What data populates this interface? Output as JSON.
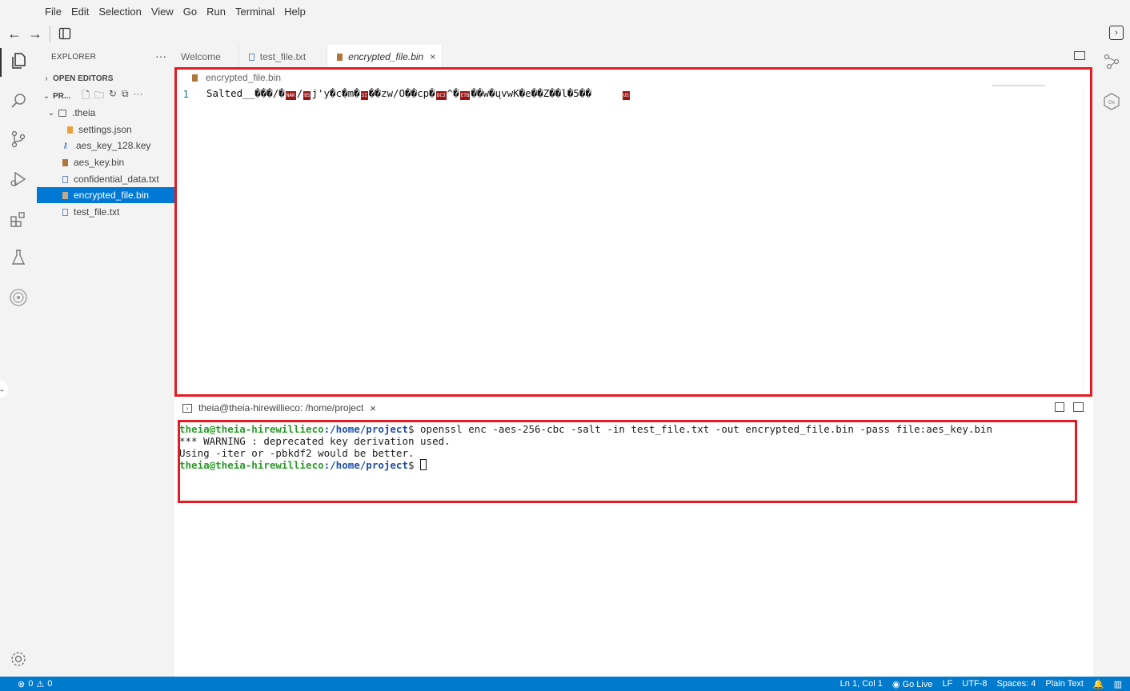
{
  "menu": {
    "items": [
      "File",
      "Edit",
      "Selection",
      "View",
      "Go",
      "Run",
      "Terminal",
      "Help"
    ]
  },
  "explorer": {
    "title": "EXPLORER",
    "open_editors": "OPEN EDITORS",
    "project": "PR...",
    "tree": [
      {
        "label": ".theia",
        "type": "folder"
      },
      {
        "label": "settings.json",
        "type": "json"
      },
      {
        "label": "aes_key_128.key",
        "type": "key"
      },
      {
        "label": "aes_key.bin",
        "type": "bin"
      },
      {
        "label": "confidential_data.txt",
        "type": "txt"
      },
      {
        "label": "encrypted_file.bin",
        "type": "bin",
        "selected": true
      },
      {
        "label": "test_file.txt",
        "type": "txt"
      }
    ]
  },
  "tabs": [
    {
      "label": "Welcome",
      "active": false
    },
    {
      "label": "test_file.txt",
      "active": false
    },
    {
      "label": "encrypted_file.bin",
      "active": true,
      "close": "×"
    }
  ],
  "editor": {
    "breadcrumb": "encrypted_file.bin",
    "line_number": "1",
    "segments": [
      {
        "t": "Salted__���/�"
      },
      {
        "cc": "NAK"
      },
      {
        "t": "/"
      },
      {
        "cc": "BS"
      },
      {
        "t": "j'y�c�m�"
      },
      {
        "cc": "SI"
      },
      {
        "t": "��zw/O��cp�"
      },
      {
        "cc": "DC3"
      },
      {
        "t": "^�"
      },
      {
        "cc": "ETB"
      },
      {
        "t": "��w�ųvwK�e��Z��l�5��     "
      },
      {
        "cc": "US"
      }
    ]
  },
  "terminal": {
    "tab_title": "theia@theia-hirewillieco: /home/project",
    "close": "×",
    "lines": [
      {
        "user": "theia@theia-hirewillieco",
        "path": ":/home/project",
        "rest": "$ openssl enc -aes-256-cbc -salt -in test_file.txt -out encrypted_file.bin -pass file:aes_key.bin"
      },
      {
        "text": "*** WARNING : deprecated key derivation used."
      },
      {
        "text": "Using -iter or -pbkdf2 would be better."
      },
      {
        "user": "theia@theia-hirewillieco",
        "path": ":/home/project",
        "rest": "$ ",
        "cursor": true
      }
    ]
  },
  "status": {
    "errors": "0",
    "warnings": "0",
    "position": "Ln 1, Col 1",
    "go_live": "Go Live",
    "eol": "LF",
    "encoding": "UTF-8",
    "spaces": "Spaces: 4",
    "language": "Plain Text"
  },
  "colors": {
    "accent": "#007acc",
    "selection": "#0078d4",
    "highlight_box": "#e41b23",
    "prompt_user": "#2a9d2a",
    "prompt_path": "#1f4fa8"
  }
}
